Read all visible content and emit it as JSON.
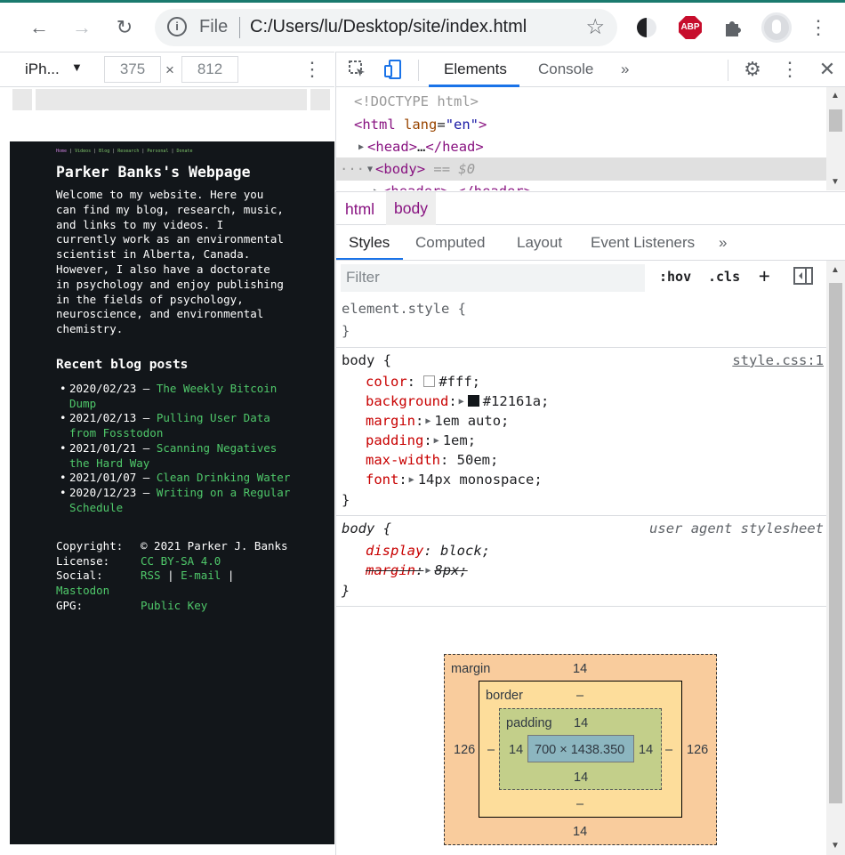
{
  "browser": {
    "url_scheme": "File",
    "url": "C:/Users/lu/Desktop/site/index.html"
  },
  "device_toolbar": {
    "device": "iPh...",
    "width": "375",
    "height": "812",
    "times": "×"
  },
  "site": {
    "nav": [
      "Home",
      "Videos",
      "Blog",
      "Research",
      "Personal",
      "Donate"
    ],
    "title": "Parker Banks's Webpage",
    "intro": "Welcome to my website. Here you can find my blog, research, music, and links to my videos. I currently work as an environmental scientist in Alberta, Canada. However, I also have a doctorate in psychology and enjoy publishing in the fields of psychology, neuroscience, and environmental chemistry.",
    "posts_heading": "Recent blog posts",
    "posts": [
      {
        "date": "2020/02/23",
        "title": "The Weekly Bitcoin Dump"
      },
      {
        "date": "2021/02/13",
        "title": "Pulling User Data from Fosstodon"
      },
      {
        "date": "2021/01/21",
        "title": "Scanning Negatives the Hard Way"
      },
      {
        "date": "2021/01/07",
        "title": "Clean Drinking Water"
      },
      {
        "date": "2020/12/23",
        "title": "Writing on a Regular Schedule"
      }
    ],
    "footer": {
      "copyright_label": "Copyright:",
      "copyright_value": "© 2021 Parker J. Banks",
      "license_label": "License:",
      "license_value": "CC BY-SA 4.0",
      "social_label": "Social:",
      "social_rss": "RSS",
      "social_email": "E-mail",
      "social_mastodon": "Mastodon",
      "gpg_label": "GPG:",
      "gpg_value": "Public Key"
    }
  },
  "devtools": {
    "tabs": [
      "Elements",
      "Console"
    ],
    "dom": {
      "doctype": "<!DOCTYPE html>",
      "html_open_tag": "html",
      "html_attr": "lang",
      "html_attr_val": "\"en\"",
      "head": "head",
      "body": "body",
      "selected_marker": "== $0",
      "header": "header"
    },
    "breadcrumbs": [
      "html",
      "body"
    ],
    "style_tabs": [
      "Styles",
      "Computed",
      "Layout",
      "Event Listeners"
    ],
    "filter_placeholder": "Filter",
    "hov": ":hov",
    "cls": ".cls",
    "element_style": "element.style {",
    "rule1": {
      "selector": "body {",
      "source": "style.css:1",
      "props": [
        {
          "name": "color",
          "value": "#fff",
          "swatch": "#ffffff"
        },
        {
          "name": "background",
          "value": "#12161a",
          "swatch": "#12161a"
        },
        {
          "name": "margin",
          "value": "1em auto;"
        },
        {
          "name": "padding",
          "value": "1em;"
        },
        {
          "name": "max-width",
          "value": "50em;"
        },
        {
          "name": "font",
          "value": "14px monospace;"
        }
      ]
    },
    "rule2": {
      "selector": "body {",
      "source": "user agent stylesheet",
      "props": [
        {
          "name": "display",
          "value": "block;"
        },
        {
          "name": "margin",
          "value": "8px;"
        }
      ]
    },
    "box_model": {
      "margin_label": "margin",
      "border_label": "border",
      "padding_label": "padding",
      "margin_top": "14",
      "margin_bottom": "14",
      "margin_left": "126",
      "margin_right": "126",
      "border_top": "–",
      "border_bottom": "–",
      "border_left": "–",
      "border_right": "–",
      "padding_top": "14",
      "padding_bottom": "14",
      "padding_left": "14",
      "padding_right": "14",
      "content": "700 × 1438.350"
    }
  }
}
